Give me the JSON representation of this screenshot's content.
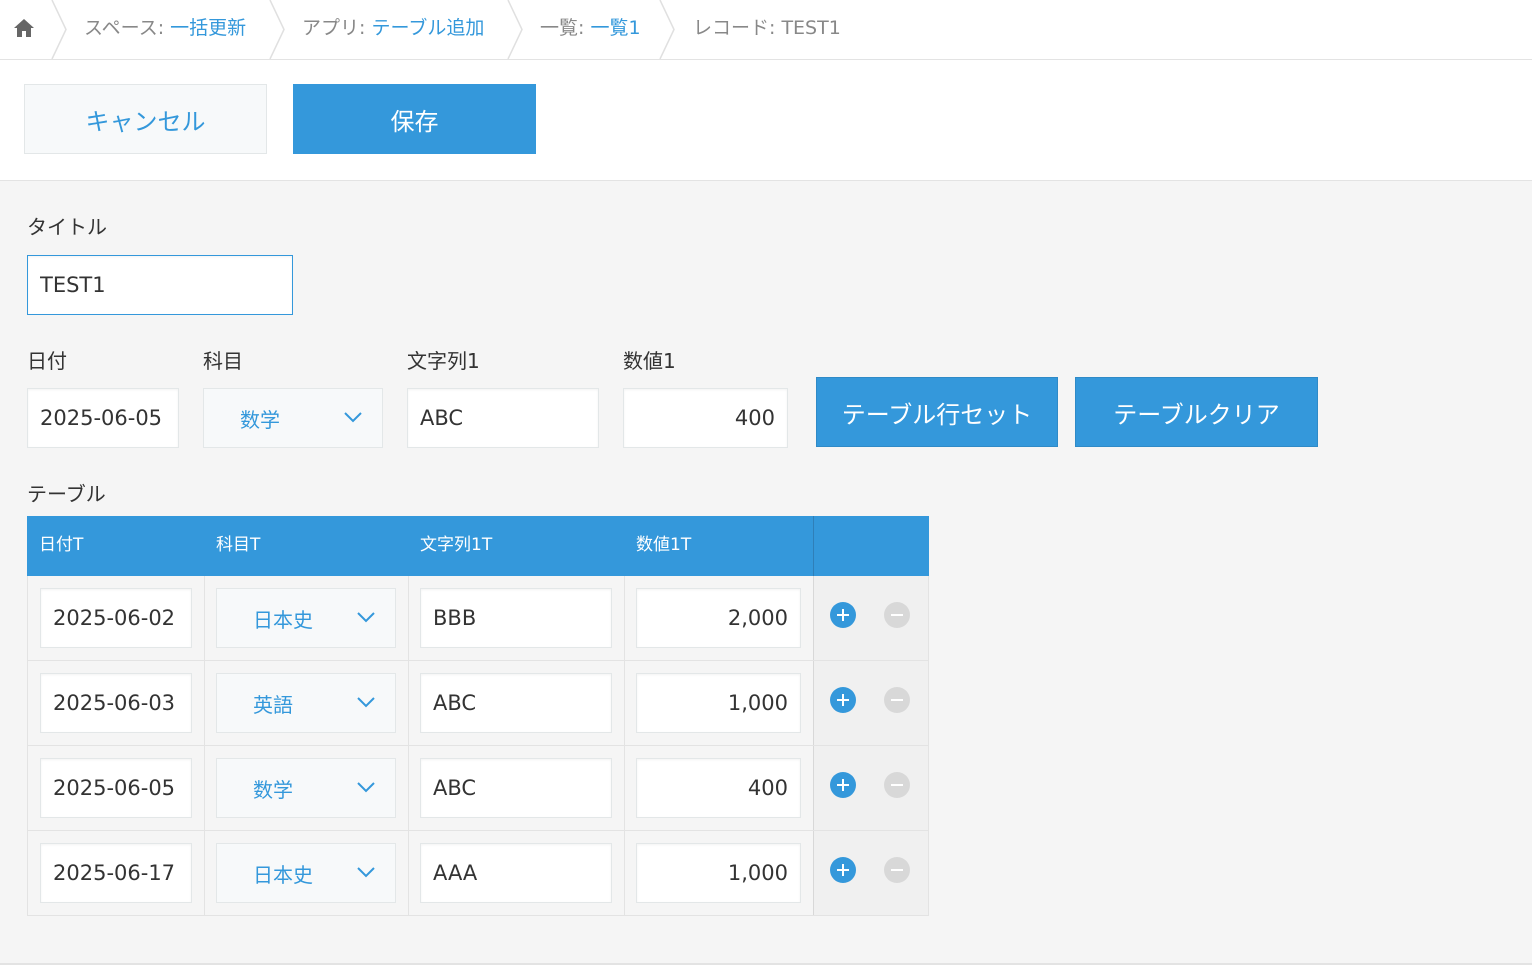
{
  "breadcrumb": {
    "space_prefix": "スペース: ",
    "space_name": "一括更新",
    "app_prefix": "アプリ: ",
    "app_name": "テーブル追加",
    "view_prefix": "一覧: ",
    "view_name": "一覧1",
    "record": "レコード: TEST1"
  },
  "toolbar": {
    "cancel_label": "キャンセル",
    "save_label": "保存"
  },
  "form": {
    "title_label": "タイトル",
    "title_value": "TEST1",
    "date_label": "日付",
    "date_value": "2025-06-05",
    "subject_label": "科目",
    "subject_value": "数学",
    "string_label": "文字列1",
    "string_value": "ABC",
    "number_label": "数値1",
    "number_value": "400",
    "set_rows_label": "テーブル行セット",
    "clear_table_label": "テーブルクリア",
    "table_label": "テーブル"
  },
  "table": {
    "headers": [
      "日付T",
      "科目T",
      "文字列1T",
      "数値1T"
    ],
    "rows": [
      {
        "date": "2025-06-02",
        "subject": "日本史",
        "text": "BBB",
        "number": "2,000"
      },
      {
        "date": "2025-06-03",
        "subject": "英語",
        "text": "ABC",
        "number": "1,000"
      },
      {
        "date": "2025-06-05",
        "subject": "数学",
        "text": "ABC",
        "number": "400"
      },
      {
        "date": "2025-06-17",
        "subject": "日本史",
        "text": "AAA",
        "number": "1,000"
      }
    ]
  },
  "colors": {
    "accent": "#3498db",
    "background": "#f5f5f5",
    "remove": "#d8d8d8"
  }
}
